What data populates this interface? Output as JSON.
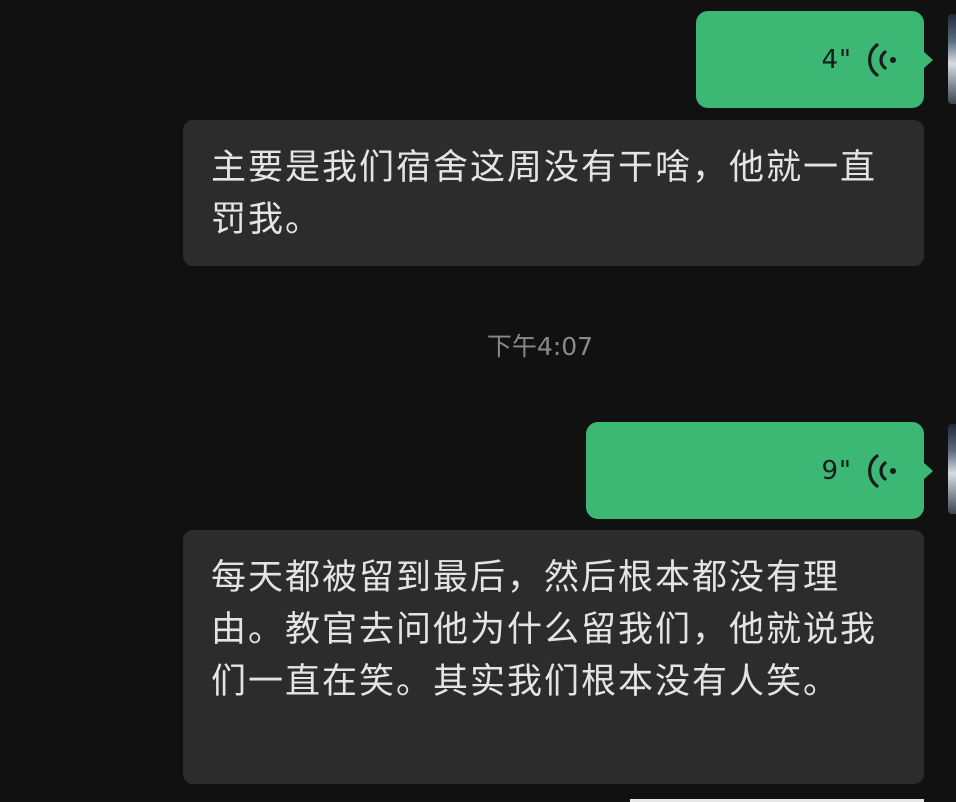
{
  "messages": [
    {
      "voice": {
        "duration": "4\""
      },
      "transcript": "主要是我们宿舍这周没有干啥，他就一直罚我。"
    },
    {
      "voice": {
        "duration": "9\""
      },
      "transcript": "每天都被留到最后，然后根本都没有理由。教官去问他为什么留我们，他就说我们一直在笑。其实我们根本没有人笑。"
    }
  ],
  "timestamp": "下午4:07",
  "icons": {
    "voice": "voice-wave-icon",
    "avatar": "avatar"
  },
  "colors": {
    "background": "#111111",
    "voice_bubble": "#3db774",
    "text_bubble": "#2c2c2c",
    "text": "#e4e4e4",
    "timestamp": "#8a8a8a"
  }
}
